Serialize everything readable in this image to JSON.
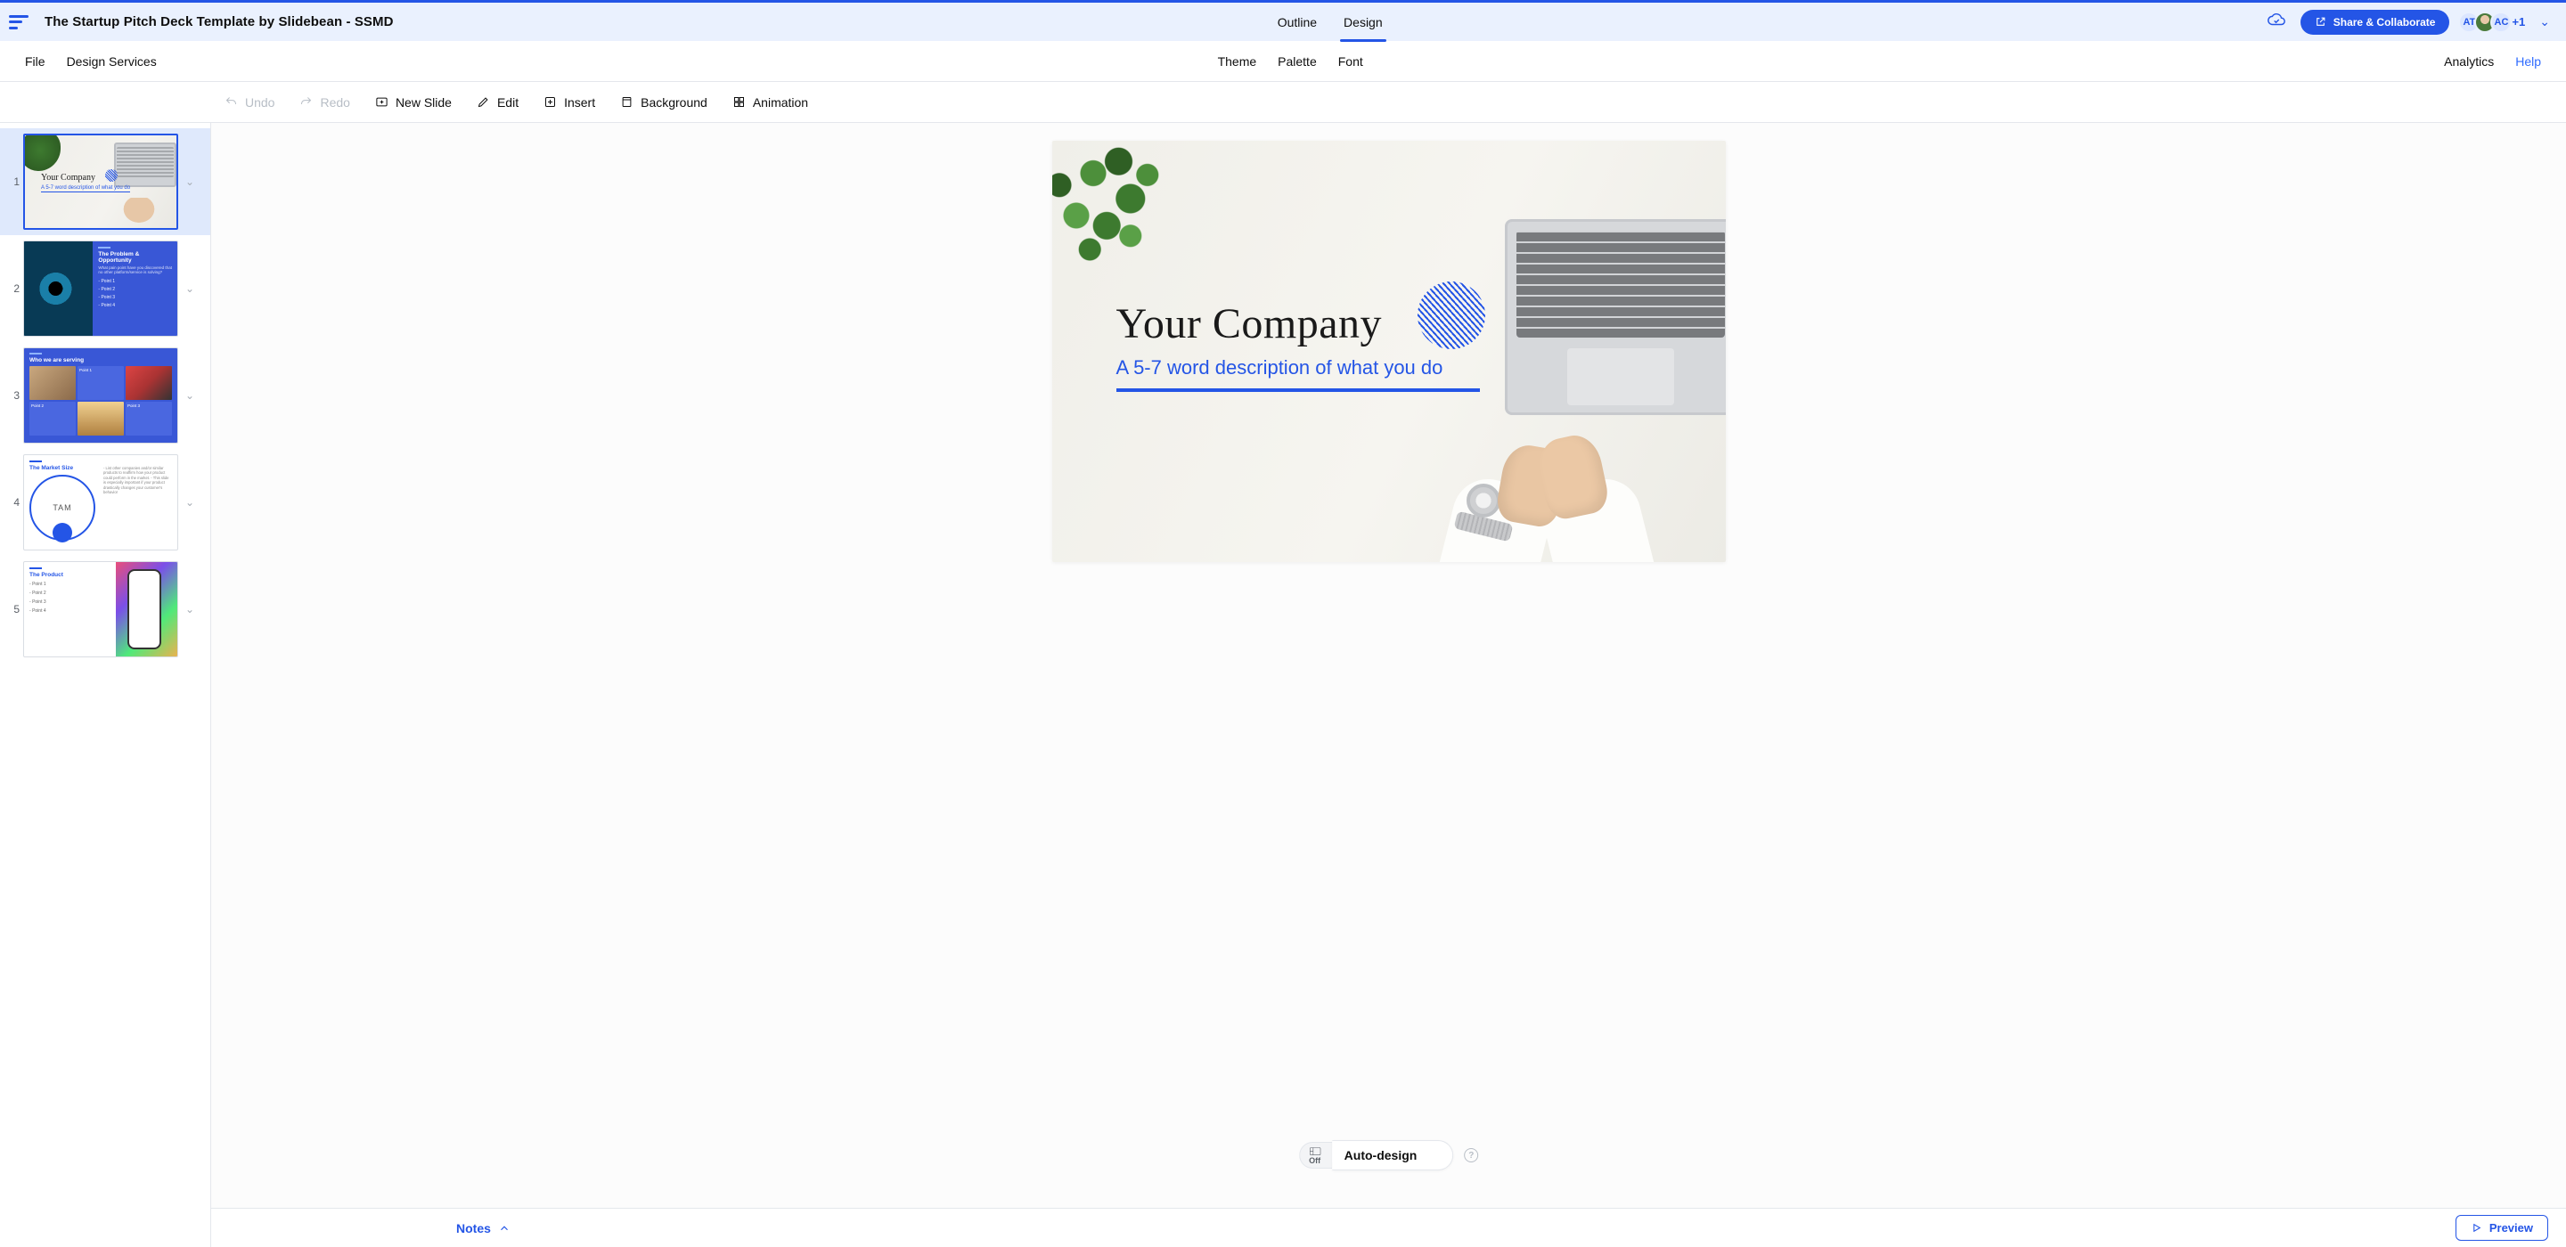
{
  "header": {
    "doc_title": "The Startup Pitch Deck Template by Slidebean - SSMD",
    "tabs": {
      "outline": "Outline",
      "design": "Design"
    },
    "share_label": "Share & Collaborate",
    "avatars": {
      "a1": "AT",
      "a2": "AC",
      "extra": "+1"
    }
  },
  "menu": {
    "file": "File",
    "design_services": "Design Services",
    "theme": "Theme",
    "palette": "Palette",
    "font": "Font",
    "analytics": "Analytics",
    "help": "Help"
  },
  "tools": {
    "undo": "Undo",
    "redo": "Redo",
    "new_slide": "New Slide",
    "edit": "Edit",
    "insert": "Insert",
    "background": "Background",
    "animation": "Animation"
  },
  "sidebar": {
    "slides": [
      {
        "n": "1",
        "title": "Your Company",
        "sub": "A 5-7 word description of what you do"
      },
      {
        "n": "2",
        "title": "The Problem & Opportunity",
        "desc": "What pain point have you discovered that no other platform/service is solving?",
        "points": [
          "Point 1",
          "Point 2",
          "Point 3",
          "Point 4"
        ]
      },
      {
        "n": "3",
        "title": "Who we are serving",
        "points": [
          "Point 1",
          "Point 2",
          "Point 3"
        ]
      },
      {
        "n": "4",
        "title": "The Market Size",
        "circle_label": "TAM",
        "copy": "- List other companies and/or similar products to reaffirm how your product could perform in the market. - This slide is especially important if your product drastically changes your customer's behavior"
      },
      {
        "n": "5",
        "title": "The Product",
        "points": [
          "Point 1",
          "Point 2",
          "Point 3",
          "Point 4"
        ]
      }
    ]
  },
  "canvas": {
    "title": "Your Company",
    "subtitle": "A 5-7 word description of what you do"
  },
  "autodesign": {
    "off": "Off",
    "label": "Auto-design"
  },
  "footer": {
    "notes": "Notes",
    "preview": "Preview"
  }
}
